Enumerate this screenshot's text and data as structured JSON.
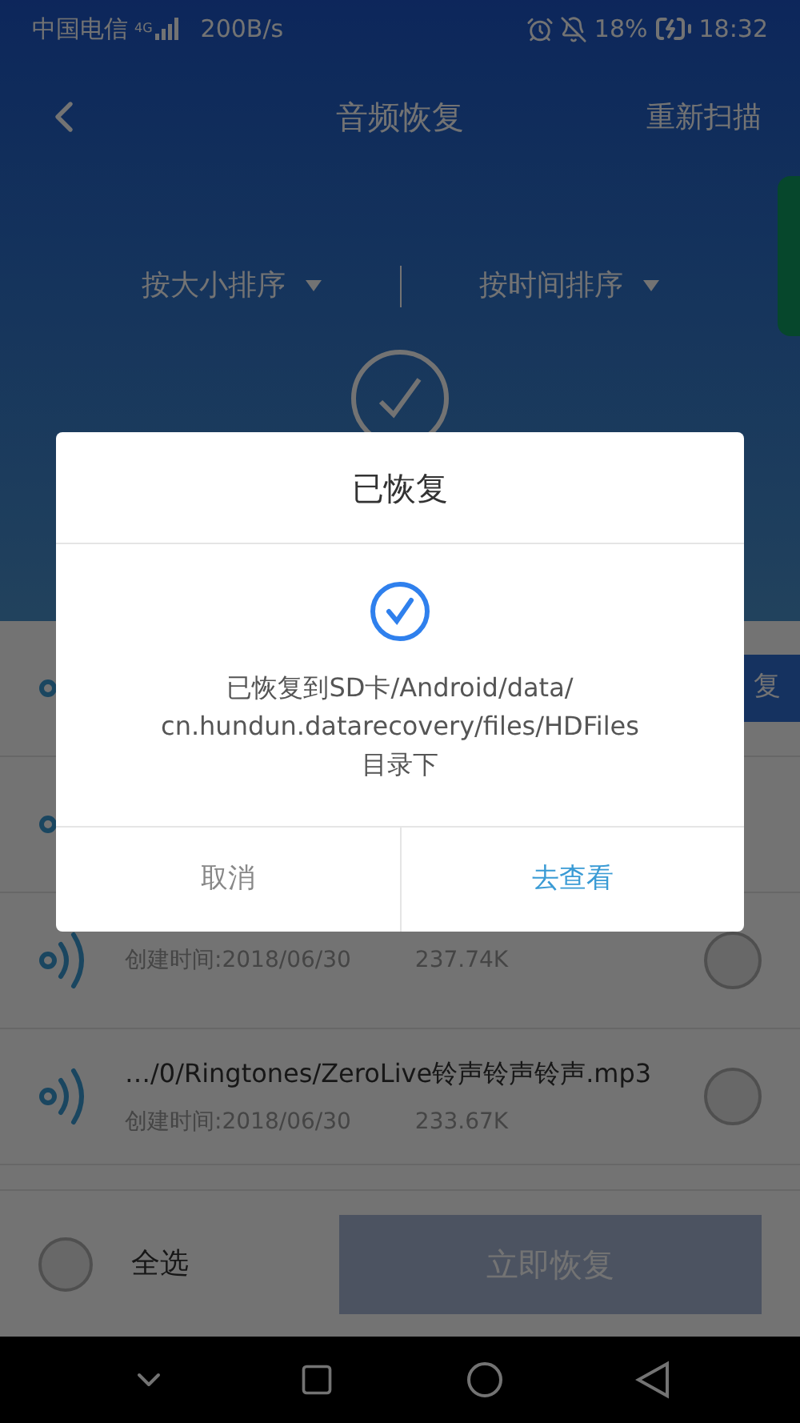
{
  "status_bar": {
    "carrier": "中国电信",
    "network": "4G",
    "speed": "200B/s",
    "battery": "18%",
    "time": "18:32"
  },
  "header": {
    "title": "音频恢复",
    "action": "重新扫描"
  },
  "sort_options": [
    {
      "label": "按大小排序"
    },
    {
      "label": "按时间排序"
    }
  ],
  "files": [
    {
      "kind": "audio",
      "action": "复"
    },
    {
      "kind": "audio"
    },
    {
      "kind": "audio",
      "created": "创建时间:2018/06/30",
      "size": "237.74K",
      "selected": false
    },
    {
      "kind": "audio",
      "name": "…/0/Ringtones/ZeroLive铃声铃声铃声.mp3",
      "created": "创建时间:2018/06/30",
      "size": "233.67K",
      "selected": false
    }
  ],
  "bottom_bar": {
    "select_all": {
      "label": "全选",
      "checked": false
    },
    "recover_button": {
      "label": "立即恢复",
      "disabled": true
    }
  },
  "dialog": {
    "title": "已恢复",
    "message_lines": [
      "已恢复到SD卡/Android/data/",
      "cn.hundun.datarecovery/files/HDFiles",
      "目录下"
    ],
    "buttons": [
      {
        "label": "取消",
        "kind": "cancel"
      },
      {
        "label": "去查看",
        "kind": "confirm"
      }
    ]
  }
}
